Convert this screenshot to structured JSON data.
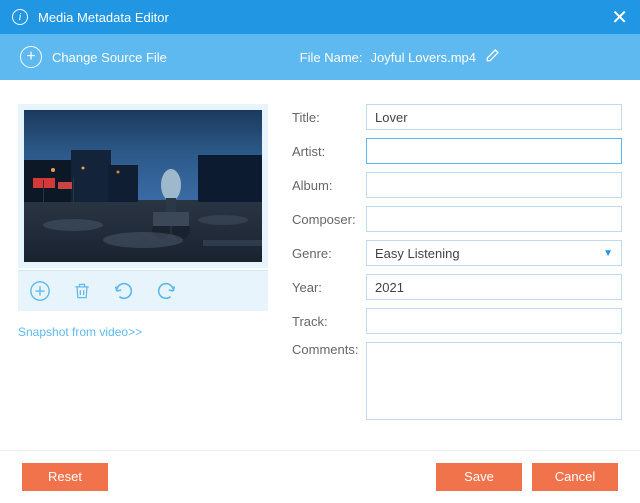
{
  "titlebar": {
    "title": "Media Metadata Editor"
  },
  "sourcebar": {
    "change_label": "Change Source File",
    "filename_label": "File Name:",
    "filename_value": "Joyful Lovers.mp4"
  },
  "snapshot_link": "Snapshot from video>>",
  "fields": {
    "title": {
      "label": "Title:",
      "value": "Lover"
    },
    "artist": {
      "label": "Artist:",
      "value": ""
    },
    "album": {
      "label": "Album:",
      "value": ""
    },
    "composer": {
      "label": "Composer:",
      "value": ""
    },
    "genre": {
      "label": "Genre:",
      "value": "Easy Listening"
    },
    "year": {
      "label": "Year:",
      "value": "2021"
    },
    "track": {
      "label": "Track:",
      "value": ""
    },
    "comments": {
      "label": "Comments:",
      "value": ""
    }
  },
  "buttons": {
    "reset": "Reset",
    "save": "Save",
    "cancel": "Cancel"
  }
}
